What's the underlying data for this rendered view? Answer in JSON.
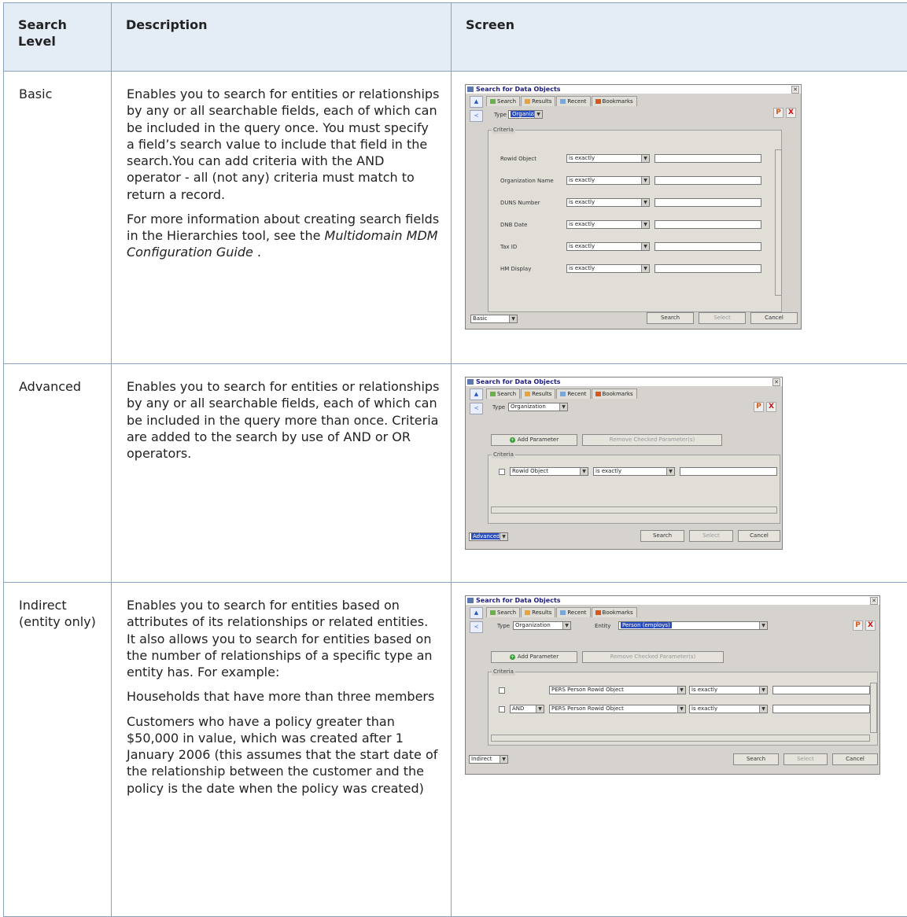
{
  "table": {
    "headers": {
      "level": "Search Level",
      "description": "Description",
      "screen": "Screen"
    },
    "rows": [
      {
        "level": "Basic",
        "desc_p1": "Enables you to search for entities or relationships by any or all searchable fields, each of which can be included in the query once. You must specify a field’s search value to include that field in the search.You can add criteria with the AND operator - all (not any) criteria must match to return a record.",
        "desc_p2_a": "For more information about creating search fields in the Hierarchies tool, see the ",
        "desc_p2_em": "Multidomain MDM Configuration Guide",
        "desc_p2_b": " ."
      },
      {
        "level": "Advanced",
        "desc_p1": "Enables you to search for entities or relationships by any or all searchable fields, each of which can be included in the query more than once. Criteria are added to the search by use of AND or OR operators."
      },
      {
        "level": "Indirect (entity only)",
        "desc_p1": "Enables you to search for entities based on attributes of its relationships or related entities. It also allows you to search for entities based on the number of relationships of a specific type an entity has. For example:",
        "desc_p2": "Households that have more than three members",
        "desc_p3": "Customers who have a policy greater than $50,000 in value, which was created after 1 January 2006 (this assumes that the start date of the relationship between the customer and the policy is the date when the policy was created)"
      }
    ]
  },
  "dialogs": {
    "basic": {
      "title": "Search for Data Objects",
      "tabs": [
        "Search",
        "Results",
        "Recent",
        "Bookmarks"
      ],
      "type_label": "Type",
      "type_value": "Organization",
      "criteria_label": "Criteria",
      "fields": [
        {
          "label": "Rowid Object",
          "op": "is exactly"
        },
        {
          "label": "Organization Name",
          "op": "is exactly"
        },
        {
          "label": "DUNS Number",
          "op": "is exactly"
        },
        {
          "label": "DNB Date",
          "op": "is exactly"
        },
        {
          "label": "Tax ID",
          "op": "is exactly"
        },
        {
          "label": "HM Display",
          "op": "is exactly"
        }
      ],
      "mode": "Basic",
      "buttons": [
        "Search",
        "Select",
        "Cancel"
      ]
    },
    "advanced": {
      "title": "Search for Data Objects",
      "tabs": [
        "Search",
        "Results",
        "Recent",
        "Bookmarks"
      ],
      "type_label": "Type",
      "type_value": "Organization",
      "add_param": "Add Parameter",
      "remove_param": "Remove Checked Parameter(s)",
      "criteria_label": "Criteria",
      "row_field": "Rowid Object",
      "row_op": "is exactly",
      "mode": "Advanced",
      "buttons": [
        "Search",
        "Select",
        "Cancel"
      ]
    },
    "indirect": {
      "title": "Search for Data Objects",
      "tabs": [
        "Search",
        "Results",
        "Recent",
        "Bookmarks"
      ],
      "type_label": "Type",
      "type_value": "Organization",
      "entity_label": "Entity",
      "entity_value": "Person (employs)",
      "add_param": "Add Parameter",
      "remove_param": "Remove Checked Parameter(s)",
      "criteria_label": "Criteria",
      "row1_field": "PERS Person Rowid Object",
      "row1_op": "is exactly",
      "row2_conj": "AND",
      "row2_field": "PERS Person Rowid Object",
      "row2_op": "is exactly",
      "mode": "Indirect",
      "buttons": [
        "Search",
        "Select",
        "Cancel"
      ]
    }
  },
  "colors": {
    "header_bg": "#e4ecf5",
    "border": "#8aa3c2",
    "dialog_bg": "#d6d3ce",
    "title_text": "#1d1d80"
  }
}
